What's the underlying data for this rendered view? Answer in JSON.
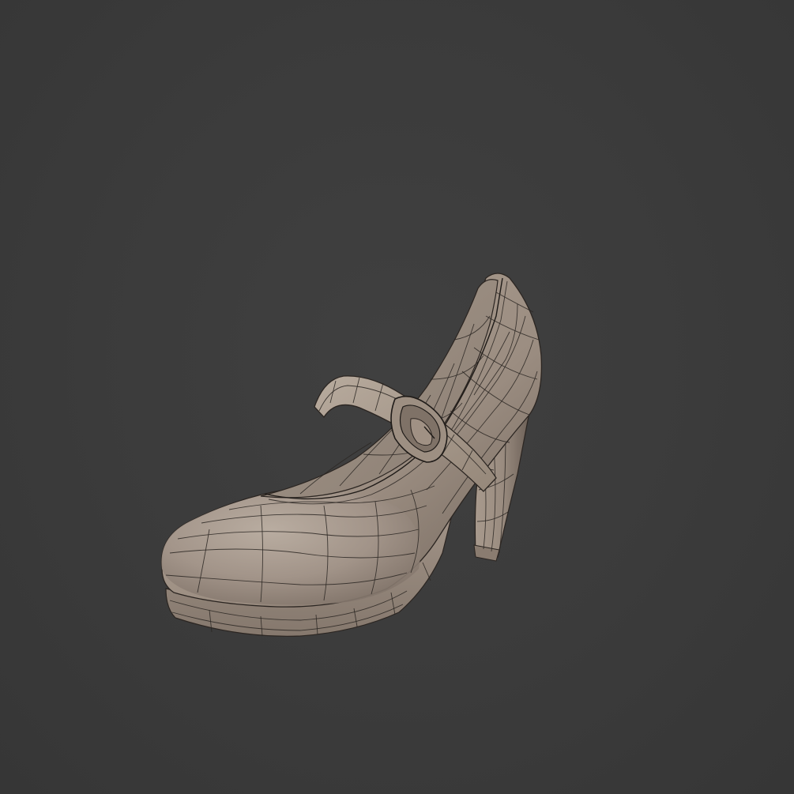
{
  "viewport": {
    "background_color": "#3a3a3a",
    "model_color": "#a89a8c",
    "wire_color": "#2a2622"
  },
  "model": {
    "subject": "shoe-icon"
  }
}
